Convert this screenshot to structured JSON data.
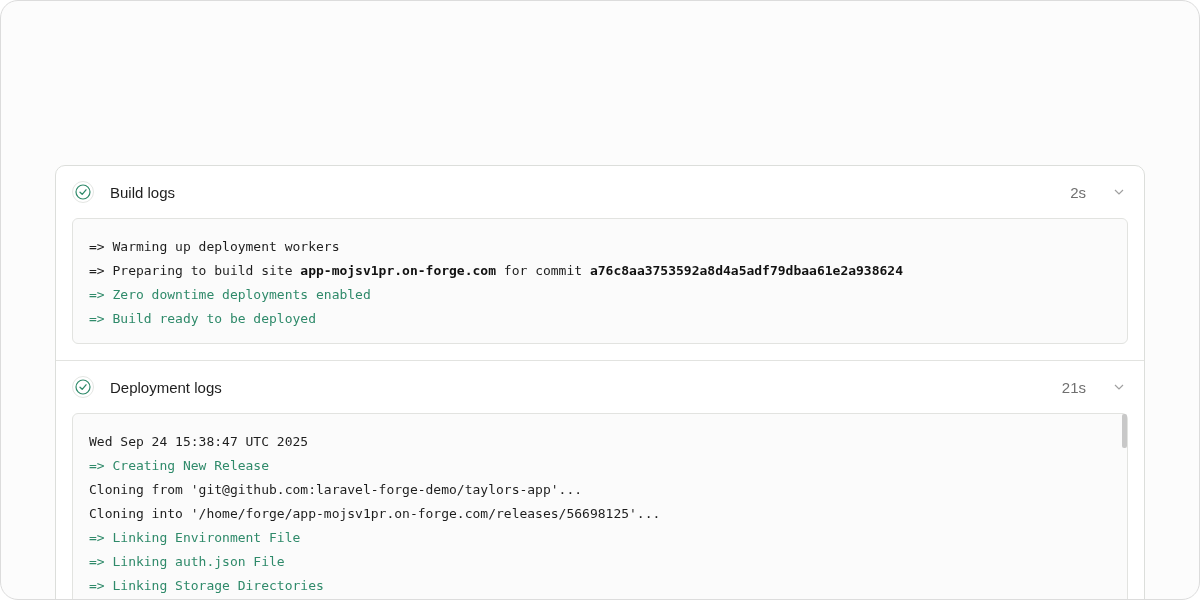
{
  "sections": [
    {
      "title": "Build logs",
      "passed": true,
      "duration": "2s",
      "expanded": true,
      "scrollable": false,
      "lines": [
        {
          "kind": "plain",
          "text": "=> Warming up deployment workers"
        },
        {
          "kind": "plain",
          "text": "=> Preparing to build site **app-mojsv1pr.on-forge.com** for commit **a76c8aa3753592a8d4a5adf79dbaa61e2a938624**"
        },
        {
          "kind": "info",
          "text": "=> Zero downtime deployments enabled"
        },
        {
          "kind": "info",
          "text": "=> Build ready to be deployed"
        }
      ]
    },
    {
      "title": "Deployment logs",
      "passed": true,
      "duration": "21s",
      "expanded": true,
      "scrollable": true,
      "lines": [
        {
          "kind": "plain",
          "text": "Wed Sep 24 15:38:47 UTC 2025"
        },
        {
          "kind": "info",
          "text": "=> Creating New Release"
        },
        {
          "kind": "plain",
          "text": "Cloning from 'git@github.com:laravel-forge-demo/taylors-app'..."
        },
        {
          "kind": "plain",
          "text": "Cloning into '/home/forge/app-mojsv1pr.on-forge.com/releases/56698125'..."
        },
        {
          "kind": "info",
          "text": "=> Linking Environment File"
        },
        {
          "kind": "info",
          "text": "=> Linking auth.json File"
        },
        {
          "kind": "info",
          "text": "=> Linking Storage Directories"
        }
      ]
    }
  ]
}
